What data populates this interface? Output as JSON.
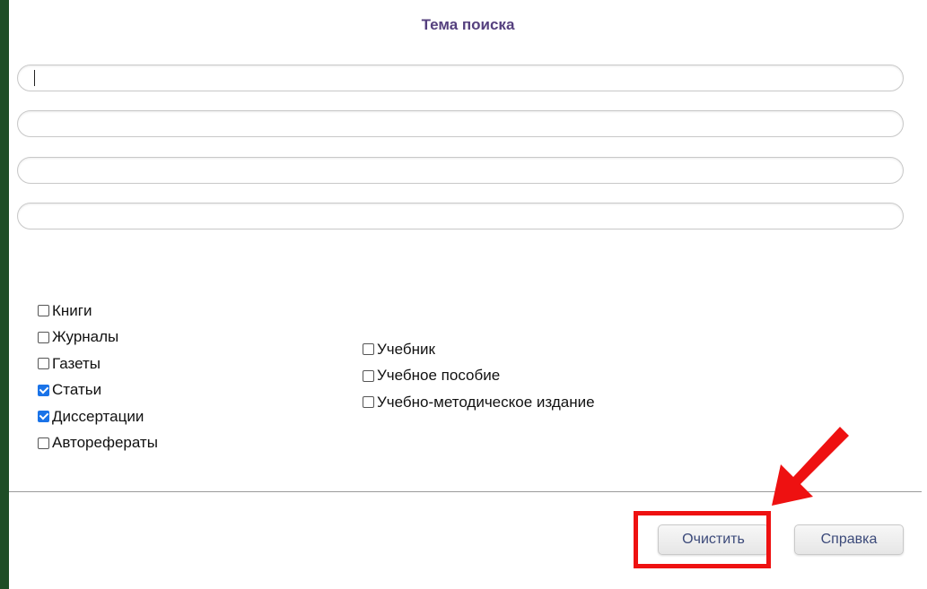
{
  "form": {
    "title": "Тема поиска",
    "fields": [
      {
        "value": "",
        "placeholder": ""
      },
      {
        "value": "",
        "placeholder": ""
      },
      {
        "value": "",
        "placeholder": ""
      },
      {
        "value": "",
        "placeholder": ""
      }
    ]
  },
  "doc_types": [
    {
      "label": "Книги",
      "checked": false
    },
    {
      "label": "Журналы",
      "checked": false
    },
    {
      "label": "Газеты",
      "checked": false
    },
    {
      "label": "Статьи",
      "checked": true
    },
    {
      "label": "Диссертации",
      "checked": true
    },
    {
      "label": "Авторефераты",
      "checked": false
    }
  ],
  "pub_types": [
    {
      "label": "Учебник",
      "checked": false
    },
    {
      "label": "Учебное пособие",
      "checked": false
    },
    {
      "label": "Учебно-методическое издание",
      "checked": false
    }
  ],
  "buttons": {
    "clear_label": "Очистить",
    "help_label": "Справка"
  },
  "colors": {
    "background": "#1e4d26",
    "title": "#55407e",
    "checkbox_checked": "#1a73e8",
    "highlight": "#ee1111"
  },
  "annotations": {
    "highlight_target": "clear-button",
    "arrow_icon": "red-arrow-icon"
  }
}
